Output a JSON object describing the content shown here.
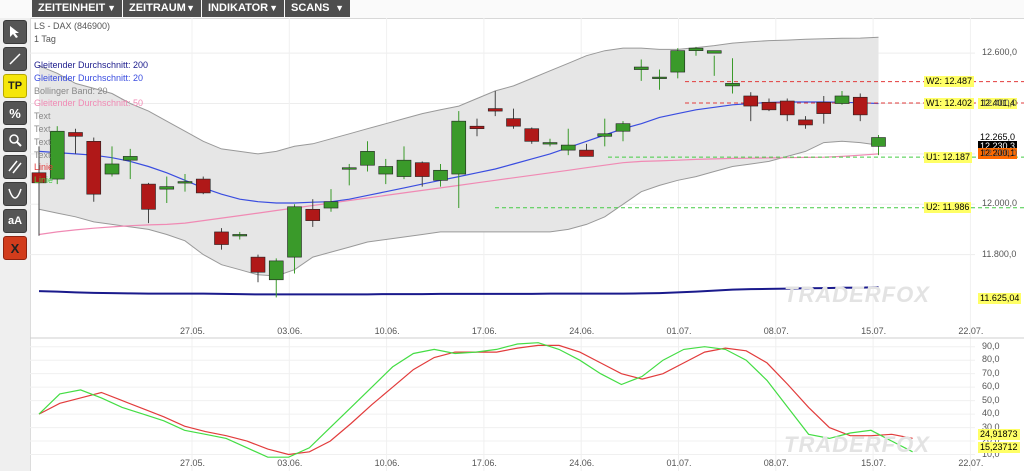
{
  "menu": [
    {
      "label": "ZEITEINHEIT",
      "arrow": "▼"
    },
    {
      "label": "ZEITRAUM",
      "arrow": "▼"
    },
    {
      "label": "INDIKATOR",
      "arrow": "▼"
    },
    {
      "label": "SCANS",
      "arrow": "▼"
    }
  ],
  "toolbar": {
    "tp_label": "TP",
    "percent_label": "%",
    "text_label": "aA",
    "delete_label": "X",
    "tools": [
      "pointer-icon",
      "line-icon",
      "tp",
      "percent",
      "search-icon",
      "parallel-lines-icon",
      "curve-icon",
      "text-size",
      "delete"
    ]
  },
  "legend": {
    "symbol": "LS - DAX (846900)",
    "period": "1 Tag",
    "items": [
      {
        "text": "Gleitender Durchschnitt: 200",
        "color": "#1a1a8c"
      },
      {
        "text": "Gleitender Durchschnitt: 20",
        "color": "#3a4de0"
      },
      {
        "text": "Bollinger Band: 20",
        "color": "#888888"
      },
      {
        "text": "Gleitender Durchschnitt: 50",
        "color": "#f08ab4"
      },
      {
        "text": "Text",
        "color": "#8a8a8a"
      },
      {
        "text": "Text",
        "color": "#8a8a8a"
      },
      {
        "text": "Text",
        "color": "#8a8a8a"
      },
      {
        "text": "Text",
        "color": "#8a8a8a"
      },
      {
        "text": "Linie",
        "color": "#e23c3c"
      },
      {
        "text": "Linie",
        "color": "#44cc44"
      }
    ]
  },
  "levels": [
    {
      "label": "W2: 12.487",
      "value": 12487,
      "color": "#e23c3c"
    },
    {
      "label": "W1: 12.402",
      "value": 12402,
      "color": "#e23c3c"
    },
    {
      "label": "U1: 12.187",
      "value": 12187,
      "color": "#44cc44"
    },
    {
      "label": "U2: 11.986",
      "value": 11986,
      "color": "#44cc44"
    }
  ],
  "price_labels": [
    {
      "text": "12.401,4",
      "value": 12401.4,
      "bg": "#ffff66",
      "fg": "#000000"
    },
    {
      "text": "12.265,5",
      "value": 12265.5,
      "bg": "#44cc44",
      "fg": "#ffffff"
    },
    {
      "text": "12.265,0",
      "value": 12265.0,
      "bg": "#ffffff",
      "fg": "#000000"
    },
    {
      "text": "12.230,3",
      "value": 12230.3,
      "bg": "#000000",
      "fg": "#ffffff"
    },
    {
      "text": "12.200,1",
      "value": 12200.1,
      "bg": "#ff6a00",
      "fg": "#000000"
    },
    {
      "text": "11.625,04",
      "value": 11625.04,
      "bg": "#ffff66",
      "fg": "#000000"
    }
  ],
  "price_axis": {
    "ticks": [
      "12.600,0",
      "12.400,0",
      "12.200,0",
      "12.000,0",
      "11.800,0"
    ],
    "tick_values": [
      12600,
      12400,
      12200,
      12000,
      11800
    ]
  },
  "osc_axis": {
    "ticks": [
      "90,0",
      "80,0",
      "70,0",
      "60,0",
      "50,0",
      "40,0",
      "30,0",
      "20,0",
      "10,0"
    ],
    "tick_values": [
      90,
      80,
      70,
      60,
      50,
      40,
      30,
      20,
      10
    ]
  },
  "osc_labels": [
    {
      "text": "24,91873",
      "value": 24.9,
      "bg": "#ffff66",
      "fg": "#000000"
    },
    {
      "text": "15,23712",
      "value": 15.2,
      "bg": "#ffff66",
      "fg": "#000000"
    }
  ],
  "date_ticks": [
    "27.05.",
    "03.06.",
    "10.06.",
    "17.06.",
    "24.06.",
    "01.07.",
    "08.07.",
    "15.07.",
    "22.07."
  ],
  "watermark": "TRADERFOX",
  "chart_data": {
    "type": "candlestick",
    "candles": [
      {
        "o": 12125,
        "h": 12230,
        "l": 11875,
        "c": 12085
      },
      {
        "o": 12100,
        "h": 12310,
        "l": 12080,
        "c": 12290
      },
      {
        "o": 12285,
        "h": 12300,
        "l": 12200,
        "c": 12270
      },
      {
        "o": 12250,
        "h": 12265,
        "l": 12010,
        "c": 12040
      },
      {
        "o": 12120,
        "h": 12230,
        "l": 12110,
        "c": 12160
      },
      {
        "o": 12175,
        "h": 12220,
        "l": 12100,
        "c": 12190
      },
      {
        "o": 12080,
        "h": 12085,
        "l": 11925,
        "c": 11980
      },
      {
        "o": 12060,
        "h": 12110,
        "l": 12005,
        "c": 12070
      },
      {
        "o": 12085,
        "h": 12120,
        "l": 12050,
        "c": 12090
      },
      {
        "o": 12100,
        "h": 12110,
        "l": 12040,
        "c": 12045
      },
      {
        "o": 11890,
        "h": 11905,
        "l": 11820,
        "c": 11840
      },
      {
        "o": 11878,
        "h": 11890,
        "l": 11860,
        "c": 11880
      },
      {
        "o": 11790,
        "h": 11800,
        "l": 11690,
        "c": 11730
      },
      {
        "o": 11700,
        "h": 11785,
        "l": 11630,
        "c": 11775
      },
      {
        "o": 11790,
        "h": 12000,
        "l": 11725,
        "c": 11990
      },
      {
        "o": 11980,
        "h": 12020,
        "l": 11910,
        "c": 11935
      },
      {
        "o": 11985,
        "h": 12060,
        "l": 11970,
        "c": 12010
      },
      {
        "o": 12140,
        "h": 12160,
        "l": 12075,
        "c": 12145
      },
      {
        "o": 12155,
        "h": 12250,
        "l": 12130,
        "c": 12210
      },
      {
        "o": 12120,
        "h": 12180,
        "l": 12080,
        "c": 12150
      },
      {
        "o": 12110,
        "h": 12230,
        "l": 12100,
        "c": 12175
      },
      {
        "o": 12165,
        "h": 12170,
        "l": 12070,
        "c": 12110
      },
      {
        "o": 12095,
        "h": 12160,
        "l": 12070,
        "c": 12135
      },
      {
        "o": 12120,
        "h": 12370,
        "l": 11985,
        "c": 12330
      },
      {
        "o": 12310,
        "h": 12340,
        "l": 12270,
        "c": 12300
      },
      {
        "o": 12380,
        "h": 12450,
        "l": 12350,
        "c": 12370
      },
      {
        "o": 12340,
        "h": 12380,
        "l": 12300,
        "c": 12310
      },
      {
        "o": 12300,
        "h": 12305,
        "l": 12240,
        "c": 12250
      },
      {
        "o": 12240,
        "h": 12260,
        "l": 12230,
        "c": 12245
      },
      {
        "o": 12215,
        "h": 12300,
        "l": 12195,
        "c": 12235
      },
      {
        "o": 12215,
        "h": 12240,
        "l": 12200,
        "c": 12190
      },
      {
        "o": 12270,
        "h": 12340,
        "l": 12230,
        "c": 12280
      },
      {
        "o": 12290,
        "h": 12330,
        "l": 12250,
        "c": 12320
      },
      {
        "o": 12535,
        "h": 12575,
        "l": 12490,
        "c": 12545
      },
      {
        "o": 12500,
        "h": 12535,
        "l": 12455,
        "c": 12505
      },
      {
        "o": 12525,
        "h": 12620,
        "l": 12500,
        "c": 12610
      },
      {
        "o": 12610,
        "h": 12625,
        "l": 12590,
        "c": 12620
      },
      {
        "o": 12600,
        "h": 12590,
        "l": 12510,
        "c": 12610
      },
      {
        "o": 12470,
        "h": 12580,
        "l": 12440,
        "c": 12480
      },
      {
        "o": 12430,
        "h": 12445,
        "l": 12330,
        "c": 12390
      },
      {
        "o": 12405,
        "h": 12420,
        "l": 12370,
        "c": 12375
      },
      {
        "o": 12410,
        "h": 12420,
        "l": 12330,
        "c": 12355
      },
      {
        "o": 12335,
        "h": 12350,
        "l": 12300,
        "c": 12315
      },
      {
        "o": 12405,
        "h": 12430,
        "l": 12320,
        "c": 12360
      },
      {
        "o": 12400,
        "h": 12450,
        "l": 12395,
        "c": 12430
      },
      {
        "o": 12425,
        "h": 12440,
        "l": 12330,
        "c": 12355
      },
      {
        "o": 12230,
        "h": 12275,
        "l": 12195,
        "c": 12265
      }
    ],
    "sma20": [
      12210,
      12205,
      12200,
      12195,
      12185,
      12170,
      12150,
      12125,
      12095,
      12065,
      12040,
      12020,
      12010,
      12005,
      12005,
      12008,
      12010,
      12020,
      12035,
      12050,
      12065,
      12080,
      12095,
      12110,
      12125,
      12140,
      12160,
      12180,
      12200,
      12225,
      12250,
      12275,
      12300,
      12320,
      12345,
      12360,
      12375,
      12385,
      12395,
      12400,
      12404,
      12406,
      12406,
      12406,
      12405,
      12403,
      12400
    ],
    "sma50": [
      11880,
      11890,
      11898,
      11905,
      11910,
      11915,
      11918,
      11920,
      11925,
      11935,
      11945,
      11955,
      11965,
      11975,
      11985,
      11995,
      12005,
      12015,
      12025,
      12035,
      12045,
      12055,
      12065,
      12075,
      12085,
      12095,
      12105,
      12115,
      12125,
      12135,
      12145,
      12155,
      12165,
      12170,
      12172,
      12175,
      12178,
      12180,
      12182,
      12183,
      12184,
      12185,
      12186,
      12187,
      12190,
      12195,
      12200
    ],
    "sma200": [
      11655,
      11653,
      11650,
      11648,
      11647,
      11646,
      11645,
      11645,
      11645,
      11645,
      11644,
      11643,
      11642,
      11642,
      11642,
      11642,
      11642,
      11642,
      11642,
      11643,
      11643,
      11643,
      11644,
      11644,
      11644,
      11644,
      11644,
      11644,
      11645,
      11645,
      11645,
      11645,
      11645,
      11646,
      11647,
      11650,
      11653,
      11657,
      11661,
      11663,
      11664,
      11665,
      11666,
      11667,
      11668,
      11669,
      11670
    ],
    "bb_upper": [
      12550,
      12520,
      12480,
      12460,
      12440,
      12400,
      12370,
      12330,
      12290,
      12250,
      12220,
      12210,
      12200,
      12210,
      12230,
      12240,
      12260,
      12280,
      12300,
      12320,
      12340,
      12360,
      12375,
      12390,
      12420,
      12450,
      12470,
      12500,
      12530,
      12560,
      12590,
      12610,
      12620,
      12620,
      12615,
      12615,
      12622,
      12630,
      12640,
      12645,
      12650,
      12652,
      12655,
      12657,
      12659,
      12660,
      12663
    ],
    "bb_lower": [
      11980,
      11965,
      11950,
      11930,
      11920,
      11910,
      11900,
      11880,
      11855,
      11800,
      11760,
      11740,
      11720,
      11715,
      11740,
      11790,
      11810,
      11830,
      11850,
      11860,
      11870,
      11880,
      11890,
      11890,
      11890,
      11890,
      11890,
      11890,
      11890,
      11900,
      11920,
      11950,
      12000,
      12050,
      12075,
      12095,
      12110,
      12130,
      12150,
      12160,
      12170,
      12190,
      12210,
      12245,
      12250,
      12245,
      12235
    ],
    "stoch_k": [
      40,
      55,
      58,
      52,
      45,
      40,
      35,
      28,
      25,
      22,
      15,
      8,
      8,
      15,
      30,
      45,
      60,
      75,
      85,
      88,
      85,
      86,
      88,
      92,
      93,
      88,
      80,
      70,
      62,
      68,
      80,
      88,
      90,
      88,
      80,
      65,
      45,
      25,
      22,
      26,
      28,
      20,
      12
    ],
    "stoch_d": [
      40,
      48,
      52,
      56,
      50,
      44,
      38,
      31,
      27,
      24,
      20,
      14,
      10,
      12,
      20,
      33,
      47,
      60,
      73,
      82,
      86,
      86,
      86,
      89,
      91,
      91,
      86,
      78,
      70,
      66,
      70,
      78,
      86,
      89,
      87,
      78,
      62,
      45,
      30,
      24,
      24,
      25,
      22
    ],
    "price_range": [
      11580,
      12700
    ],
    "osc_range": [
      0,
      95
    ]
  }
}
